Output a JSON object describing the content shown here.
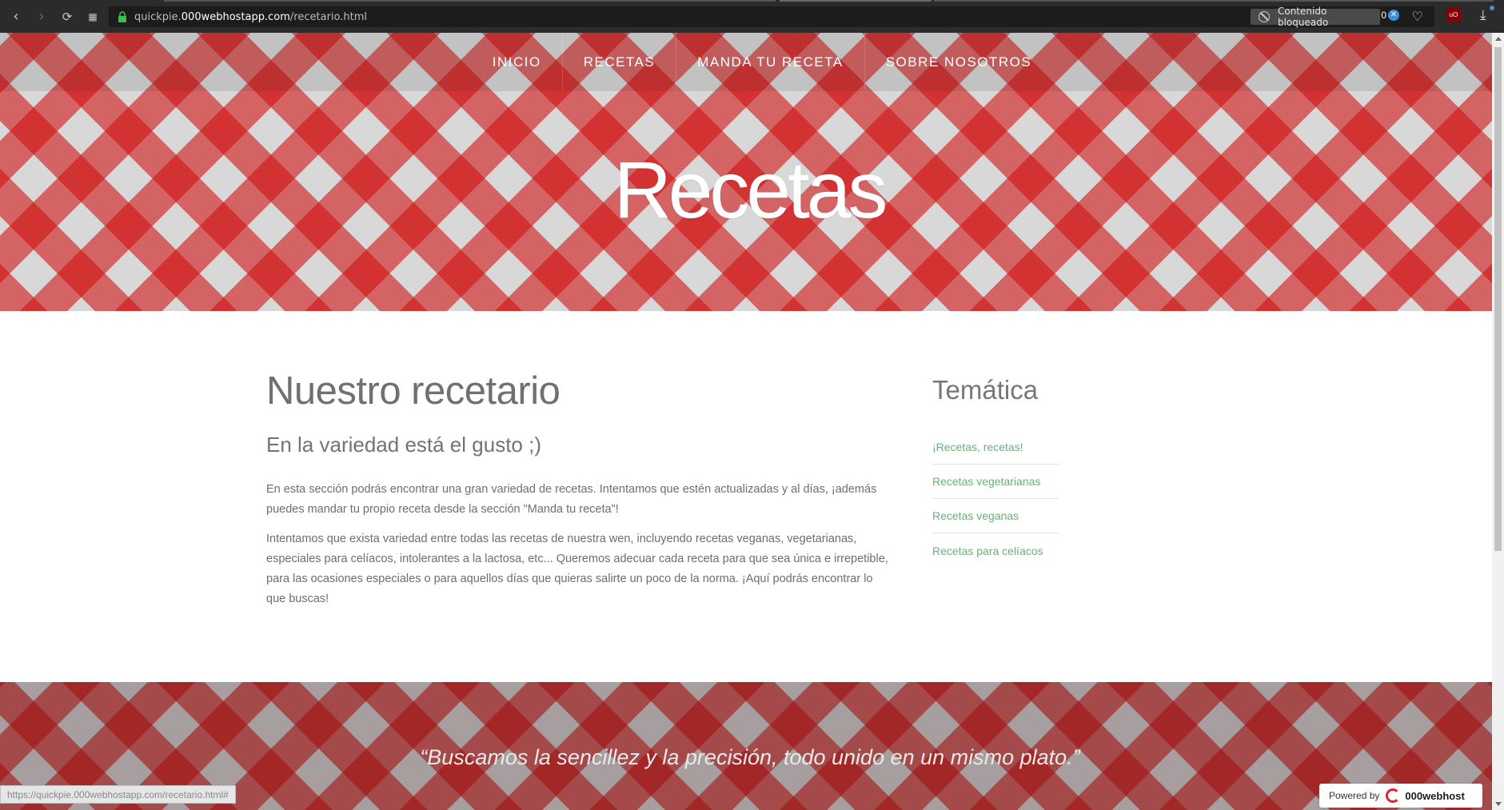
{
  "browser": {
    "url_prefix": "quickpie.",
    "url_host": "000webhostapp.com",
    "url_path": "/recetario.html",
    "blocked_label": "Contenido bloqueado",
    "blocked_count": "0"
  },
  "nav": {
    "items": [
      {
        "label": "INICIO"
      },
      {
        "label": "RECETAS"
      },
      {
        "label": "MANDA TU RECETA"
      },
      {
        "label": "SOBRE NOSOTROS"
      }
    ]
  },
  "hero": {
    "title": "Recetas"
  },
  "main": {
    "heading": "Nuestro recetario",
    "subheading": "En la variedad está el gusto ;)",
    "paragraph1": "En esta sección podrás encontrar una gran variedad de recetas. Intentamos que estén actualizadas y al días, ¡además puedes mandar tu propio receta desde la sección \"Manda tu receta\"!",
    "paragraph2": "Intentamos que exista variedad entre todas las recetas de nuestra wen, incluyendo recetas veganas, vegetarianas, especiales para celíacos, intolerantes a la lactosa, etc... Queremos adecuar cada receta para que sea única e irrepetible, para las ocasiones especiales o para aquellos días que quieras salirte un poco de la norma. ¡Aquí podrás encontrar lo que buscas!"
  },
  "sidebar": {
    "title": "Temática",
    "links": [
      {
        "label": "¡Recetas, recetas!"
      },
      {
        "label": "Recetas vegetarianas"
      },
      {
        "label": "Recetas veganas"
      },
      {
        "label": "Recetas para celíacos"
      }
    ]
  },
  "footer": {
    "quote": "“Buscamos la sencillez y la precisión, todo unido en un mismo plato.”",
    "status_url": "https://quickpie.000webhostapp.com/recetario.html#",
    "powered_label": "Powered by",
    "powered_brand": "000webhost"
  },
  "colors": {
    "accent_red": "#d20f0f",
    "link_green": "#6ab078",
    "text_gray": "#6e6e6e"
  }
}
